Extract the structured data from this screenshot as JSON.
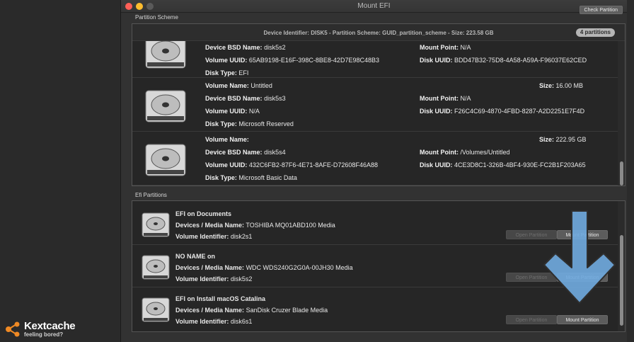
{
  "window": {
    "title": "Mount EFI",
    "check_button": "Check Partition"
  },
  "partition_scheme": {
    "section_label": "Partition Scheme",
    "header": "Device Identifier: DISK5 - Partition Scheme: GUID_partition_scheme - Size: 223.58 GB",
    "badge": "4 partitions",
    "partitions": [
      {
        "device_bsd_name": "disk5s2",
        "mount_point": "N/A",
        "volume_uuid": "65AB9198-E16F-398C-8BE8-42D7E98C48B3",
        "disk_uuid": "BDD47B32-75D8-4A58-A59A-F96037E62CED",
        "disk_type": "EFI"
      },
      {
        "volume_name": "Untitled",
        "size": "16.00 MB",
        "device_bsd_name": "disk5s3",
        "mount_point": "N/A",
        "volume_uuid": "N/A",
        "disk_uuid": "F26C4C69-4870-4FBD-8287-A2D2251E7F4D",
        "disk_type": "Microsoft Reserved"
      },
      {
        "volume_name": "",
        "size": "222.95 GB",
        "device_bsd_name": "disk5s4",
        "mount_point": "/Volumes/Untitled",
        "volume_uuid": "432C6FB2-87F6-4E71-8AFE-D72608F46A88",
        "disk_uuid": "4CE3D8C1-326B-4BF4-930E-FC2B1F203A65",
        "disk_type": "Microsoft Basic Data"
      }
    ],
    "labels": {
      "volume_name": "Volume Name:",
      "device_bsd_name": "Device BSD Name:",
      "volume_uuid": "Volume UUID:",
      "disk_type": "Disk Type:",
      "mount_point": "Mount Point:",
      "disk_uuid": "Disk UUID:",
      "size": "Size:"
    }
  },
  "efi_partitions": {
    "section_label": "Efi Partitions",
    "labels": {
      "media": "Devices / Media Name:",
      "volume_identifier": "Volume Identifier:"
    },
    "open_button": "Open Partition",
    "mount_button": "Mount Partition",
    "items": [
      {
        "title": "EFI on Documents",
        "media": "TOSHIBA MQ01ABD100 Media",
        "volume_identifier": "disk2s1"
      },
      {
        "title": "NO NAME on",
        "media": "WDC WDS240G2G0A-00JH30 Media",
        "volume_identifier": "disk5s2"
      },
      {
        "title": "EFI on Install macOS Catalina",
        "media": "SanDisk Cruzer Blade Media",
        "volume_identifier": "disk6s1"
      }
    ]
  },
  "overlay": {
    "arrow_color": "#6fa8dc",
    "logo_text": "Kextcache",
    "logo_sub": "feeling bored?",
    "logo_color": "#f08a24"
  }
}
